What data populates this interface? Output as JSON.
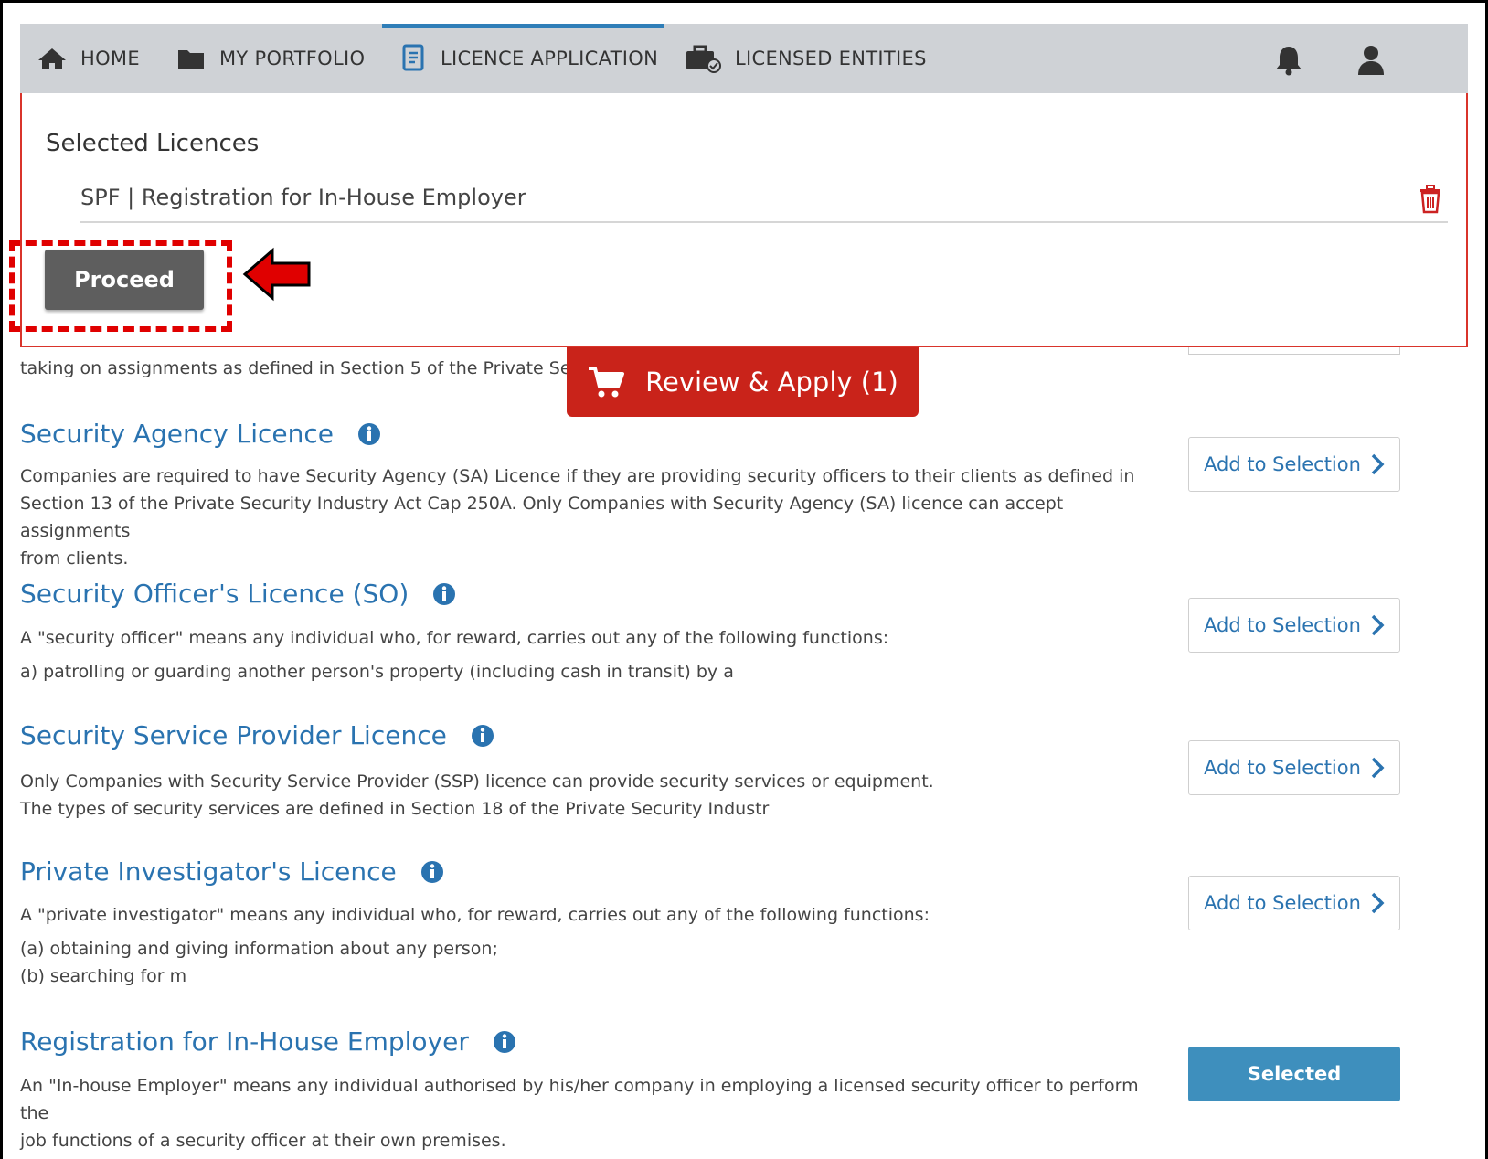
{
  "nav": {
    "items": [
      {
        "label": "HOME",
        "icon": "home-icon"
      },
      {
        "label": "MY PORTFOLIO",
        "icon": "folder-icon"
      },
      {
        "label": "LICENCE APPLICATION",
        "icon": "document-icon",
        "active": true
      },
      {
        "label": "LICENSED ENTITIES",
        "icon": "briefcase-check-icon"
      }
    ],
    "right_icons": [
      "bell-icon",
      "user-icon"
    ]
  },
  "selected_panel": {
    "title": "Selected Licences",
    "items": [
      {
        "label": "SPF | Registration for In-House Employer"
      }
    ],
    "proceed_label": "Proceed"
  },
  "review_button": {
    "label": "Review & Apply (1)"
  },
  "partial_item": {
    "desc": "taking on assignments as defined in Section 5 of the Private Sec"
  },
  "licences": [
    {
      "title": "Security Agency Licence",
      "lines": [
        "Companies are required to have Security Agency (SA) Licence if they are providing security officers to their clients as defined in",
        "Section 13 of the Private Security Industry Act Cap 250A. Only Companies with Security Agency (SA) licence can accept assignments",
        "from clients."
      ],
      "button": "Add to Selection"
    },
    {
      "title": "Security Officer's Licence (SO)",
      "lines": [
        "A \"security officer\" means any individual who, for reward, carries out any of the following functions:",
        "a) patrolling or guarding another person's property (including cash in transit) by a"
      ],
      "button": "Add to Selection"
    },
    {
      "title": "Security Service Provider Licence",
      "lines": [
        "Only Companies with Security Service Provider (SSP) licence can provide security services or equipment.",
        "The types of security services are defined in Section 18 of the Private Security Industr"
      ],
      "button": "Add to Selection"
    },
    {
      "title": "Private Investigator's Licence",
      "lines": [
        "A \"private investigator\" means any individual who, for reward, carries out any of the following functions:",
        "(a) obtaining and giving information about any person;",
        "(b) searching for m"
      ],
      "button": "Add to Selection"
    },
    {
      "title": "Registration for In-House Employer",
      "lines": [
        "An \"In-house Employer\" means any individual authorised by his/her company in employing a licensed security officer to perform the",
        "job functions of a security officer at their own premises."
      ],
      "button": "Selected"
    }
  ],
  "colors": {
    "nav_bg": "#cfd2d6",
    "accent_blue": "#2a73b0",
    "review_red": "#c9231a",
    "selected_blue": "#3e8fbd",
    "annotation_red": "#e00000"
  }
}
